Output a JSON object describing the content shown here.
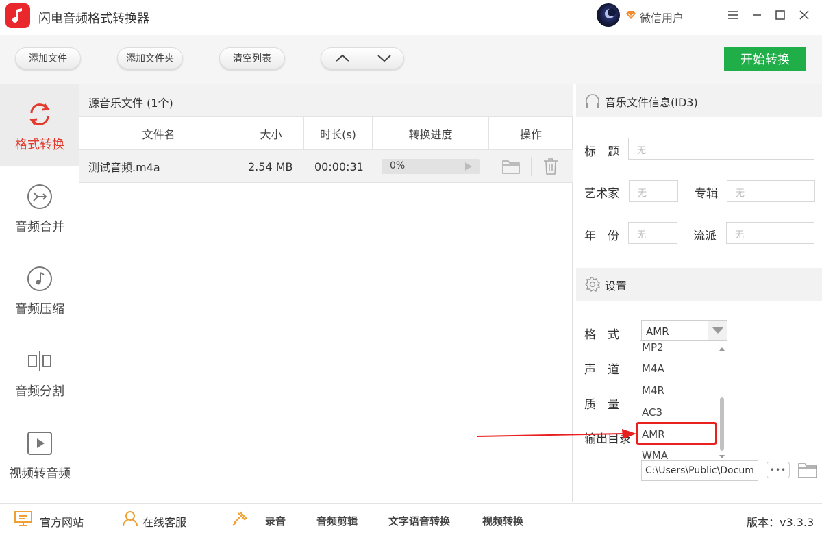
{
  "app": {
    "title": "闪电音频格式转换器",
    "user_name": "微信用户"
  },
  "toolbar": {
    "add_file": "添加文件",
    "add_folder": "添加文件夹",
    "clear_list": "清空列表",
    "start": "开始转换"
  },
  "sidebar": {
    "items": [
      {
        "label": "格式转换",
        "icon": "refresh-icon",
        "active": true
      },
      {
        "label": "音频合并",
        "icon": "merge-icon"
      },
      {
        "label": "音频压缩",
        "icon": "music-note-icon"
      },
      {
        "label": "音频分割",
        "icon": "split-icon"
      },
      {
        "label": "视频转音频",
        "icon": "video-play-icon"
      }
    ]
  },
  "files": {
    "header": "源音乐文件 (1个)",
    "columns": [
      "文件名",
      "大小",
      "时长(s)",
      "转换进度",
      "操作"
    ],
    "rows": [
      {
        "name": "测试音频.m4a",
        "size": "2.54 MB",
        "duration": "00:00:31",
        "progress": "0%"
      }
    ]
  },
  "id3": {
    "header": "音乐文件信息(ID3)",
    "title_label": "标　题",
    "artist_label": "艺术家",
    "album_label": "专辑",
    "year_label": "年　份",
    "genre_label": "流派",
    "placeholder": "无"
  },
  "settings": {
    "header": "设置",
    "format_label": "格　式",
    "channel_label": "声　道",
    "quality_label": "质　量",
    "output_label": "输出目录",
    "format_value": "AMR",
    "format_options": [
      "MP2",
      "M4A",
      "M4R",
      "AC3",
      "AMR",
      "WMA"
    ],
    "output_dir": "C:\\Users\\Public\\Docum",
    "more": "•••"
  },
  "footer": {
    "website": "官方网站",
    "service": "在线客服",
    "record": "录音",
    "edit": "音频剪辑",
    "tts": "文字语音转换",
    "video": "视频转换",
    "version": "版本：v3.3.3"
  },
  "colors": {
    "accent_red": "#e23a2e",
    "start_green": "#1fae47",
    "annotation_red": "#e8201f"
  }
}
